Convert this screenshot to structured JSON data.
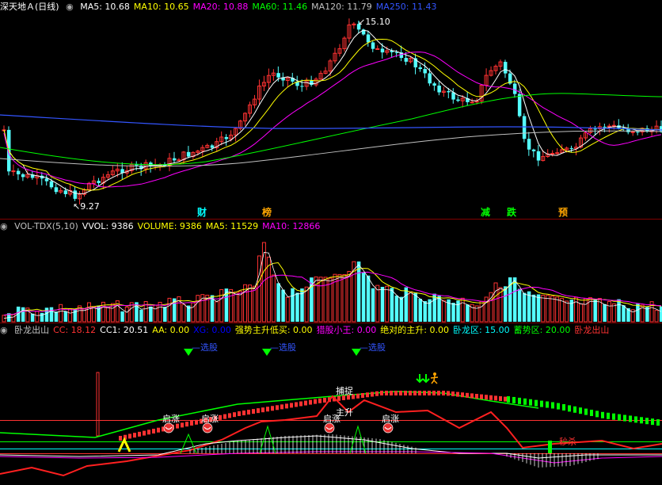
{
  "price_panel": {
    "title": "深天地Ａ(日线)",
    "ma": [
      {
        "label": "MA5: 10.68",
        "color": "#ffffff"
      },
      {
        "label": "MA10: 10.65",
        "color": "#ffff00"
      },
      {
        "label": "MA20: 10.88",
        "color": "#ff00ff"
      },
      {
        "label": "MA60: 11.46",
        "color": "#00ff00"
      },
      {
        "label": "MA120: 11.79",
        "color": "#c0c0c0"
      },
      {
        "label": "MA250: 11.43",
        "color": "#3355ff"
      }
    ],
    "high_label": "15.10",
    "low_label": "9.27",
    "events": [
      {
        "label": "财",
        "color": "#00ffff",
        "x": 255
      },
      {
        "label": "榜",
        "color": "#ffa500",
        "x": 337
      },
      {
        "label": "减",
        "color": "#00ff00",
        "x": 613
      },
      {
        "label": "跌",
        "color": "#00ff00",
        "x": 646
      },
      {
        "label": "预",
        "color": "#ffa500",
        "x": 711
      }
    ]
  },
  "volume_panel": {
    "items": [
      {
        "label": "VOL-TDX(5,10)",
        "color": "#c0c0c0"
      },
      {
        "label": "VVOL: 9386",
        "color": "#ffffff"
      },
      {
        "label": "VOLUME: 9386",
        "color": "#ffff00"
      },
      {
        "label": "MA5: 11529",
        "color": "#ffff00"
      },
      {
        "label": "MA10: 12866",
        "color": "#ff00ff"
      }
    ]
  },
  "indicator_panel": {
    "items": [
      {
        "label": "卧龙出山",
        "color": "#c0c0c0"
      },
      {
        "label": "CC: 18.12",
        "color": "#ff3333"
      },
      {
        "label": "CC1: 20.51",
        "color": "#ffffff"
      },
      {
        "label": "AA: 0.00",
        "color": "#ffff00"
      },
      {
        "label": "XG: 0.00",
        "color": "#0000ff"
      },
      {
        "label": "强势主升低买: 0.00",
        "color": "#ffff00"
      },
      {
        "label": "猎股小王: 0.00",
        "color": "#ff00ff"
      },
      {
        "label": "绝对的主升: 0.00",
        "color": "#ffff00"
      },
      {
        "label": "卧龙区: 15.00",
        "color": "#00ffff"
      },
      {
        "label": "蓄势区: 20.00",
        "color": "#00ff00"
      },
      {
        "label": "卧龙出山",
        "color": "#ff3333"
      }
    ],
    "xuan_gu": "选股",
    "qi_zhang": "启涨",
    "bu_zhuo": "捕捉",
    "zhu_sheng": "主升",
    "miao_sha": "秒杀"
  },
  "chart_data": {
    "type": "candlestick",
    "series": [
      {
        "name": "MA5",
        "value": 10.68
      },
      {
        "name": "MA10",
        "value": 10.65
      },
      {
        "name": "MA20",
        "value": 10.88
      },
      {
        "name": "MA60",
        "value": 11.46
      },
      {
        "name": "MA120",
        "value": 11.79
      },
      {
        "name": "MA250",
        "value": 11.43
      }
    ],
    "high": 15.1,
    "low": 9.27,
    "volume": {
      "VVOL": 9386,
      "VOLUME": 9386,
      "MA5": 11529,
      "MA10": 12866
    },
    "indicator": {
      "CC": 18.12,
      "CC1": 20.51,
      "AA": 0.0,
      "XG": 0.0,
      "强势主升低买": 0.0,
      "猎股小王": 0.0,
      "绝对的主升": 0.0,
      "卧龙区": 15.0,
      "蓄势区": 20.0
    }
  }
}
